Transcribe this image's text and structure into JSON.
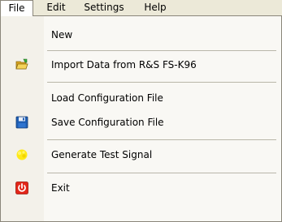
{
  "menubar": {
    "file": "File",
    "edit": "Edit",
    "settings": "Settings",
    "help": "Help"
  },
  "file_menu": {
    "items": [
      {
        "label": "New",
        "icon": null
      },
      {
        "label": "Import Data from R&S FS-K96",
        "icon": "folder-open-icon"
      },
      {
        "label": "Load Configuration File",
        "icon": null
      },
      {
        "label": "Save Configuration File",
        "icon": "floppy-disk-icon"
      },
      {
        "label": "Generate Test Signal",
        "icon": "signal-icon"
      },
      {
        "label": "Exit",
        "icon": "power-icon"
      }
    ]
  },
  "colors": {
    "menubar_bg": "#ece9d8",
    "menu_bg": "#f9f8f4",
    "exit_red": "#e32619",
    "save_blue": "#1f5fb4",
    "signal_yellow": "#ffe800",
    "folder_yellow": "#f2c230"
  }
}
